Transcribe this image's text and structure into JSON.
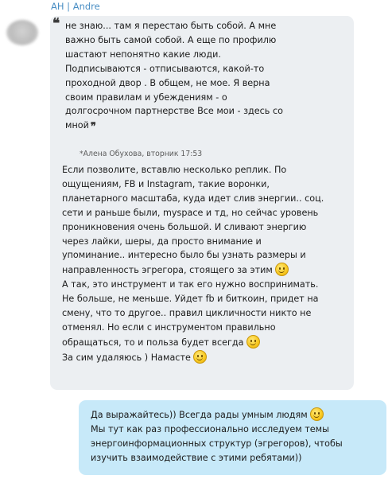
{
  "conversation": {
    "sender_name": "AH | Andre",
    "incoming": {
      "quote": {
        "lines": [
          "не знаю... там я перестаю быть собой. А мне",
          "важно быть самой собой. А еще по профилю",
          "шастают непонятно какие люди.",
          "Подписываются - отписываются, какой-то",
          "проходной двор . В общем, не мое. Я верна",
          "своим правилам и убеждениям - о",
          "долгосрочном партнерстве Все мои - здесь со",
          "мной"
        ],
        "open_mark": "❝",
        "close_mark": "❞",
        "meta": "*Алена Обухова, вторник 17:53"
      },
      "lines": [
        "Если позволите, вставлю несколько реплик. По",
        "ощущениям, FB и Instagram, такие воронки,",
        "планетарного масштаба, куда идет слив энергии..  соц.",
        "сети и раньше были, myspace и тд, но сейчас уровень",
        "проникновения очень большой. И сливают энергию",
        "через лайки, шеры, да просто внимание и",
        "упоминание.. интересно было бы узнать размеры и",
        "направленность эгрегора, стоящего за этим",
        "А так, это инструмент и так его нужно воспринимать.",
        "Не больше, не меньше. Уйдет fb и биткоин, придет на",
        "смену, что то другое.. правил цикличности никто не",
        "отменял.  Но если с инструментом правильно",
        "обращаться, то и польза будет всегда",
        "За сим удаляюсь ) Намасте"
      ],
      "emoji_names": [
        "smile-emoji",
        "smile-emoji",
        "halo-smile-emoji"
      ]
    },
    "outgoing": {
      "lines": [
        "Да выражайтесь)) Всегда рады умным людям",
        "Мы тут как раз профессионально исследуем темы",
        "энергоинформационных структур (эгрегоров), чтобы",
        "изучить взаимодействие с этими ребятами))"
      ],
      "emoji_names": [
        "grin-emoji"
      ]
    }
  }
}
